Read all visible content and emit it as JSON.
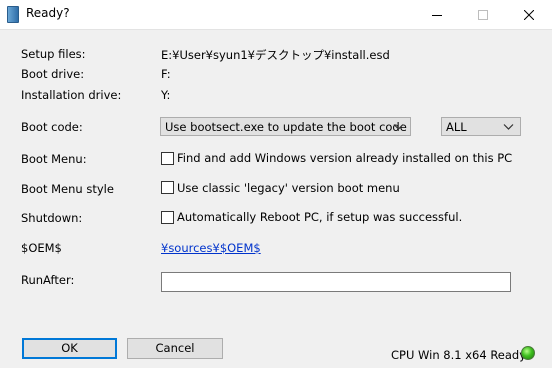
{
  "window": {
    "title": "Ready?",
    "icon": "document-icon",
    "controls": {
      "minimize": "minimize-icon",
      "maximize": "maximize-icon",
      "close": "close-icon"
    }
  },
  "info": {
    "setup_files_label": "Setup files:",
    "setup_files_value": "E:¥User¥syun1¥デスクトップ¥install.esd",
    "boot_drive_label": "Boot drive:",
    "boot_drive_value": "F:",
    "install_drive_label": "Installation drive:",
    "install_drive_value": "Y:"
  },
  "boot_code": {
    "label": "Boot code:",
    "method_selected": "Use bootsect.exe to update the boot code",
    "target_selected": "ALL"
  },
  "boot_menu": {
    "label": "Boot Menu:",
    "checkbox_label": "Find and add Windows version already installed on this PC",
    "checked": false
  },
  "boot_menu_style": {
    "label": "Boot Menu style",
    "checkbox_label": "Use classic 'legacy' version boot menu",
    "checked": false
  },
  "shutdown": {
    "label": "Shutdown:",
    "checkbox_label": "Automatically Reboot PC, if setup was successful.",
    "checked": false
  },
  "oem": {
    "label": "$OEM$",
    "link": "¥sources¥$OEM$"
  },
  "run_after": {
    "label": "RunAfter:",
    "value": ""
  },
  "buttons": {
    "ok": "OK",
    "cancel": "Cancel"
  },
  "status": {
    "text": "CPU Win 8.1 x64 Ready",
    "indicator_color": "#3fbf1f"
  }
}
